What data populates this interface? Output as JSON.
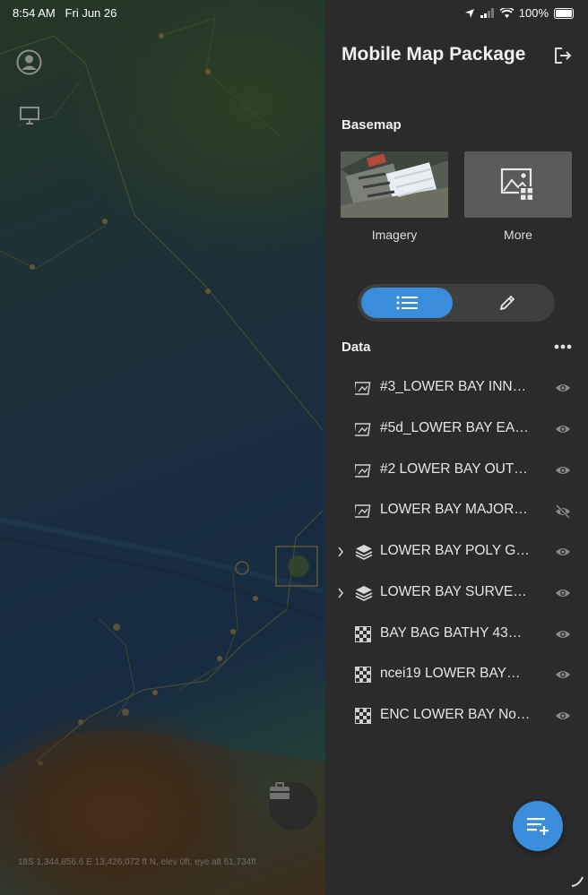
{
  "status_bar": {
    "time": "8:54 AM",
    "date": "Fri Jun 26",
    "battery": "100%"
  },
  "map": {
    "coordinates": "18S 1,344,856.6 E 13,426,072 ft N, elev 0ft, eye alt 61,734ft"
  },
  "panel": {
    "title": "Mobile Map Package",
    "basemap": {
      "heading": "Basemap",
      "options": [
        {
          "label": "Imagery",
          "icon": "aerial-imagery-thumbnail"
        },
        {
          "label": "More",
          "icon": "image-gallery-icon"
        }
      ]
    },
    "view_toggle": {
      "selected": "list",
      "options": [
        "list",
        "edit"
      ]
    },
    "data": {
      "heading": "Data",
      "layers": [
        {
          "name": "#3_LOWER BAY INN…",
          "type": "feature-layer-icon",
          "expandable": false,
          "visible": true
        },
        {
          "name": "#5d_LOWER BAY EA…",
          "type": "feature-layer-icon",
          "expandable": false,
          "visible": true
        },
        {
          "name": "#2 LOWER BAY OUT…",
          "type": "feature-layer-icon",
          "expandable": false,
          "visible": true
        },
        {
          "name": "LOWER BAY MAJOR…",
          "type": "feature-layer-icon",
          "expandable": false,
          "visible": false
        },
        {
          "name": "LOWER BAY POLY G…",
          "type": "group-layer-icon",
          "expandable": true,
          "visible": true
        },
        {
          "name": "LOWER BAY SURVEY…",
          "type": "group-layer-icon",
          "expandable": true,
          "visible": true
        },
        {
          "name": "BAY BAG BATHY 43…",
          "type": "raster-layer-icon",
          "expandable": false,
          "visible": true
        },
        {
          "name": "ncei19 LOWER BAY…",
          "type": "raster-layer-icon",
          "expandable": false,
          "visible": true
        },
        {
          "name": "ENC LOWER BAY No…",
          "type": "raster-layer-icon",
          "expandable": false,
          "visible": true
        }
      ]
    }
  },
  "colors": {
    "accent": "#3a8ddb",
    "panel_bg": "#2b2b2b"
  }
}
